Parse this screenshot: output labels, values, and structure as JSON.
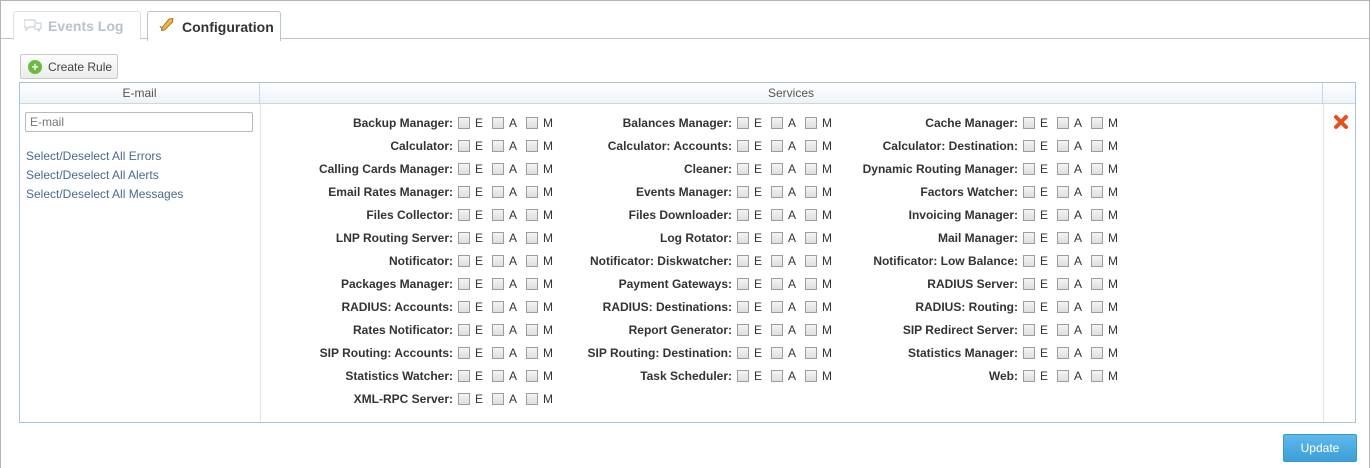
{
  "tabs": [
    {
      "label": "Events Log",
      "active": false
    },
    {
      "label": "Configuration",
      "active": true
    }
  ],
  "toolbar": {
    "create_rule_label": "Create Rule"
  },
  "table": {
    "headers": {
      "email": "E-mail",
      "services": "Services"
    },
    "email_placeholder": "E-mail",
    "email_value": "",
    "links": {
      "errors": "Select/Deselect All Errors",
      "alerts": "Select/Deselect All Alerts",
      "messages": "Select/Deselect All Messages"
    },
    "flag_labels": [
      "E",
      "A",
      "M"
    ],
    "services_columns": [
      [
        "Backup Manager:",
        "Calculator:",
        "Calling Cards Manager:",
        "Email Rates Manager:",
        "Files Collector:",
        "LNP Routing Server:",
        "Notificator:",
        "Packages Manager:",
        "RADIUS: Accounts:",
        "Rates Notificator:",
        "SIP Routing: Accounts:",
        "Statistics Watcher:",
        "XML-RPC Server:"
      ],
      [
        "Balances Manager:",
        "Calculator: Accounts:",
        "Cleaner:",
        "Events Manager:",
        "Files Downloader:",
        "Log Rotator:",
        "Notificator: Diskwatcher:",
        "Payment Gateways:",
        "RADIUS: Destinations:",
        "Report Generator:",
        "SIP Routing: Destination:",
        "Task Scheduler:"
      ],
      [
        "Cache Manager:",
        "Calculator: Destination:",
        "Dynamic Routing Manager:",
        "Factors Watcher:",
        "Invoicing Manager:",
        "Mail Manager:",
        "Notificator: Low Balance:",
        "RADIUS Server:",
        "RADIUS: Routing:",
        "SIP Redirect Server:",
        "Statistics Manager:",
        "Web:"
      ]
    ]
  },
  "footer": {
    "update_label": "Update"
  },
  "colors": {
    "accent": "#3da0d8",
    "delete": "#e2521d",
    "link": "#4a6b8c",
    "create_icon": "#6dbb3c"
  }
}
